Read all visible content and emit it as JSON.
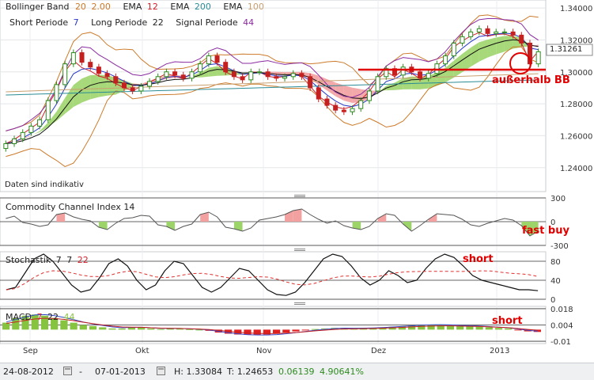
{
  "legend_main": {
    "bb_name": "Bollinger Band",
    "bb_p1": "20",
    "bb_p2": "2.00",
    "ema_label": "EMA",
    "ema1": "12",
    "ema2": "200",
    "ema3": "100",
    "short_label": "Short Periode",
    "short_val": "7",
    "long_label": "Long Periode",
    "long_val": "22",
    "signal_label": "Signal Periode",
    "signal_val": "44"
  },
  "disclaimer": "Daten sind indikativ",
  "current_price": "1.31261",
  "annotations": {
    "outside_bb": "außerhalb BB",
    "fast_buy": "fast buy",
    "short1": "short",
    "short2": "short"
  },
  "cci_label": "Commodity Channel Index 14",
  "stoch_label": {
    "name": "Stochastik",
    "p1": "7",
    "p2": "7",
    "p3": "22"
  },
  "macd_label": {
    "name": "MACD",
    "p1": "7",
    "p2": "22",
    "p3": "44"
  },
  "footer": {
    "from_date": "24-08-2012",
    "to_date": "07-01-2013",
    "high_label": "H: 1.33084",
    "low_label": "T: 1.24653",
    "change_abs": "0.06139",
    "change_pct": "4.90641%"
  },
  "colors": {
    "bb": "#cc7a29",
    "ema12": "#d21f2a",
    "ema200": "#2a8c96",
    "ema100": "#c8a070",
    "short": "#2436c8",
    "long": "#111111",
    "signal": "#8a2ba0",
    "cloud_green": "#9dd46a",
    "cloud_red": "#f2a0a0",
    "up": "#2e8b1e",
    "down": "#c42020",
    "annotation": "#e00000",
    "macd_pos": "#86c440",
    "macd_neg": "#e02020"
  },
  "chart_data": [
    {
      "type": "line",
      "title": "",
      "x_ticks": [
        "Sep",
        "Okt",
        "Nov",
        "Dez",
        "2013"
      ],
      "y_ticks": [
        "1.34000",
        "1.32000",
        "1.30000",
        "1.28000",
        "1.26000",
        "1.24000"
      ],
      "ylim": [
        1.225,
        1.345
      ],
      "price_close": [
        1.255,
        1.258,
        1.262,
        1.266,
        1.27,
        1.282,
        1.292,
        1.305,
        1.312,
        1.306,
        1.303,
        1.299,
        1.297,
        1.293,
        1.29,
        1.288,
        1.291,
        1.294,
        1.297,
        1.3,
        1.298,
        1.296,
        1.3,
        1.305,
        1.31,
        1.306,
        1.3,
        1.297,
        1.295,
        1.3,
        1.3,
        1.297,
        1.296,
        1.297,
        1.299,
        1.297,
        1.29,
        1.283,
        1.279,
        1.276,
        1.275,
        1.277,
        1.282,
        1.288,
        1.297,
        1.302,
        1.298,
        1.303,
        1.3,
        1.296,
        1.299,
        1.305,
        1.31,
        1.318,
        1.322,
        1.325,
        1.327,
        1.324,
        1.325,
        1.325,
        1.323,
        1.318,
        1.305,
        1.31261
      ],
      "series": [
        {
          "name": "Bollinger Band",
          "role": "upper"
        },
        {
          "name": "Bollinger Band",
          "role": "lower"
        },
        {
          "name": "EMA 12"
        },
        {
          "name": "EMA 200"
        },
        {
          "name": "EMA 100"
        },
        {
          "name": "Short Periode 7"
        },
        {
          "name": "Long Periode 22"
        },
        {
          "name": "Signal Periode 44"
        }
      ],
      "horizontal_line": 1.3005
    },
    {
      "type": "area",
      "title": "Commodity Channel Index 14",
      "y_ticks": [
        "300",
        "0",
        "-300"
      ],
      "ylim": [
        -300,
        300
      ],
      "values": [
        40,
        70,
        -10,
        -30,
        -60,
        -40,
        90,
        110,
        60,
        30,
        10,
        -70,
        -100,
        -20,
        40,
        50,
        80,
        70,
        -40,
        -60,
        -110,
        -60,
        -30,
        90,
        120,
        60,
        -70,
        -90,
        -120,
        -80,
        20,
        40,
        60,
        90,
        140,
        160,
        90,
        30,
        -20,
        10,
        -50,
        -80,
        -100,
        -60,
        40,
        100,
        80,
        -30,
        -120,
        -50,
        30,
        100,
        90,
        80,
        30,
        -40,
        -60,
        -20,
        10,
        40,
        20,
        -50,
        -180,
        -120
      ]
    },
    {
      "type": "line",
      "title": "Stochastik 7 7 22",
      "y_ticks": [
        "80",
        "40",
        "0"
      ],
      "ylim": [
        0,
        100
      ],
      "k_values": [
        20,
        25,
        55,
        85,
        95,
        80,
        55,
        30,
        15,
        20,
        45,
        75,
        85,
        70,
        40,
        20,
        30,
        60,
        80,
        75,
        50,
        25,
        15,
        25,
        45,
        65,
        60,
        40,
        20,
        10,
        8,
        15,
        35,
        60,
        85,
        95,
        90,
        70,
        45,
        30,
        40,
        60,
        50,
        35,
        40,
        65,
        85,
        95,
        88,
        70,
        50,
        40,
        35,
        30,
        25,
        20,
        20,
        18
      ]
    },
    {
      "type": "bar",
      "title": "MACD 7 22 44",
      "y_ticks": [
        "0.018",
        "0.004",
        "-0.01"
      ],
      "ylim": [
        -0.012,
        0.02
      ],
      "values": [
        0.006,
        0.01,
        0.012,
        0.013,
        0.012,
        0.01,
        0.008,
        0.006,
        0.004,
        0.003,
        0.002,
        0.001,
        0.001,
        0.002,
        0.002,
        0.001,
        0.0005,
        0.001,
        0.0008,
        0.0004,
        0.0,
        -0.001,
        -0.0025,
        -0.0035,
        -0.0042,
        -0.0045,
        -0.0045,
        -0.0042,
        -0.0035,
        -0.0025,
        -0.0015,
        -0.0005,
        0.0005,
        0.001,
        0.0015,
        0.0015,
        0.001,
        0.0012,
        0.0015,
        0.002,
        0.0025,
        0.003,
        0.0035,
        0.004,
        0.004,
        0.004,
        0.0035,
        0.003,
        0.003,
        0.0025,
        0.002,
        0.0015,
        0.001,
        -0.0005,
        -0.0015,
        -0.002
      ]
    }
  ]
}
